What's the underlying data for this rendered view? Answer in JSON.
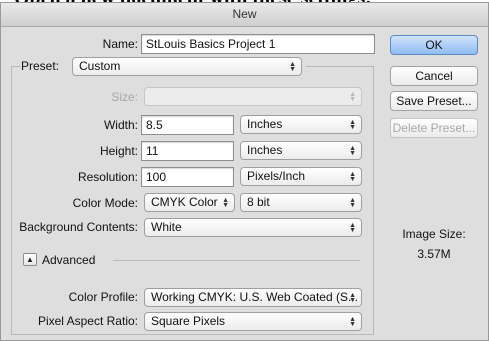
{
  "caption": "Open a new document with these settings:",
  "dialog": {
    "title": "New",
    "name": {
      "label": "Name:",
      "value": "StLouis Basics Project 1"
    },
    "preset": {
      "label": "Preset:",
      "value": "Custom"
    },
    "size": {
      "label": "Size:",
      "value": ""
    },
    "width": {
      "label": "Width:",
      "value": "8.5",
      "unit": "Inches"
    },
    "height": {
      "label": "Height:",
      "value": "11",
      "unit": "Inches"
    },
    "resolution": {
      "label": "Resolution:",
      "value": "100",
      "unit": "Pixels/Inch"
    },
    "color_mode": {
      "label": "Color Mode:",
      "value": "CMYK Color",
      "depth": "8 bit"
    },
    "background": {
      "label": "Background Contents:",
      "value": "White"
    },
    "advanced": {
      "label": "Advanced",
      "expand_icon": "triangle-up-icon"
    },
    "color_profile": {
      "label": "Color Profile:",
      "value": "Working CMYK:  U.S. Web Coated (S..."
    },
    "pixel_aspect": {
      "label": "Pixel Aspect Ratio:",
      "value": "Square Pixels"
    },
    "buttons": {
      "ok": "OK",
      "cancel": "Cancel",
      "save_preset": "Save Preset...",
      "delete_preset": "Delete Preset..."
    },
    "image_size": {
      "label": "Image Size:",
      "value": "3.57M"
    },
    "colors": {
      "ok_button": "#8fbcf2",
      "dialog_bg": "#dedede",
      "disabled_text": "#a8a8a8"
    }
  }
}
